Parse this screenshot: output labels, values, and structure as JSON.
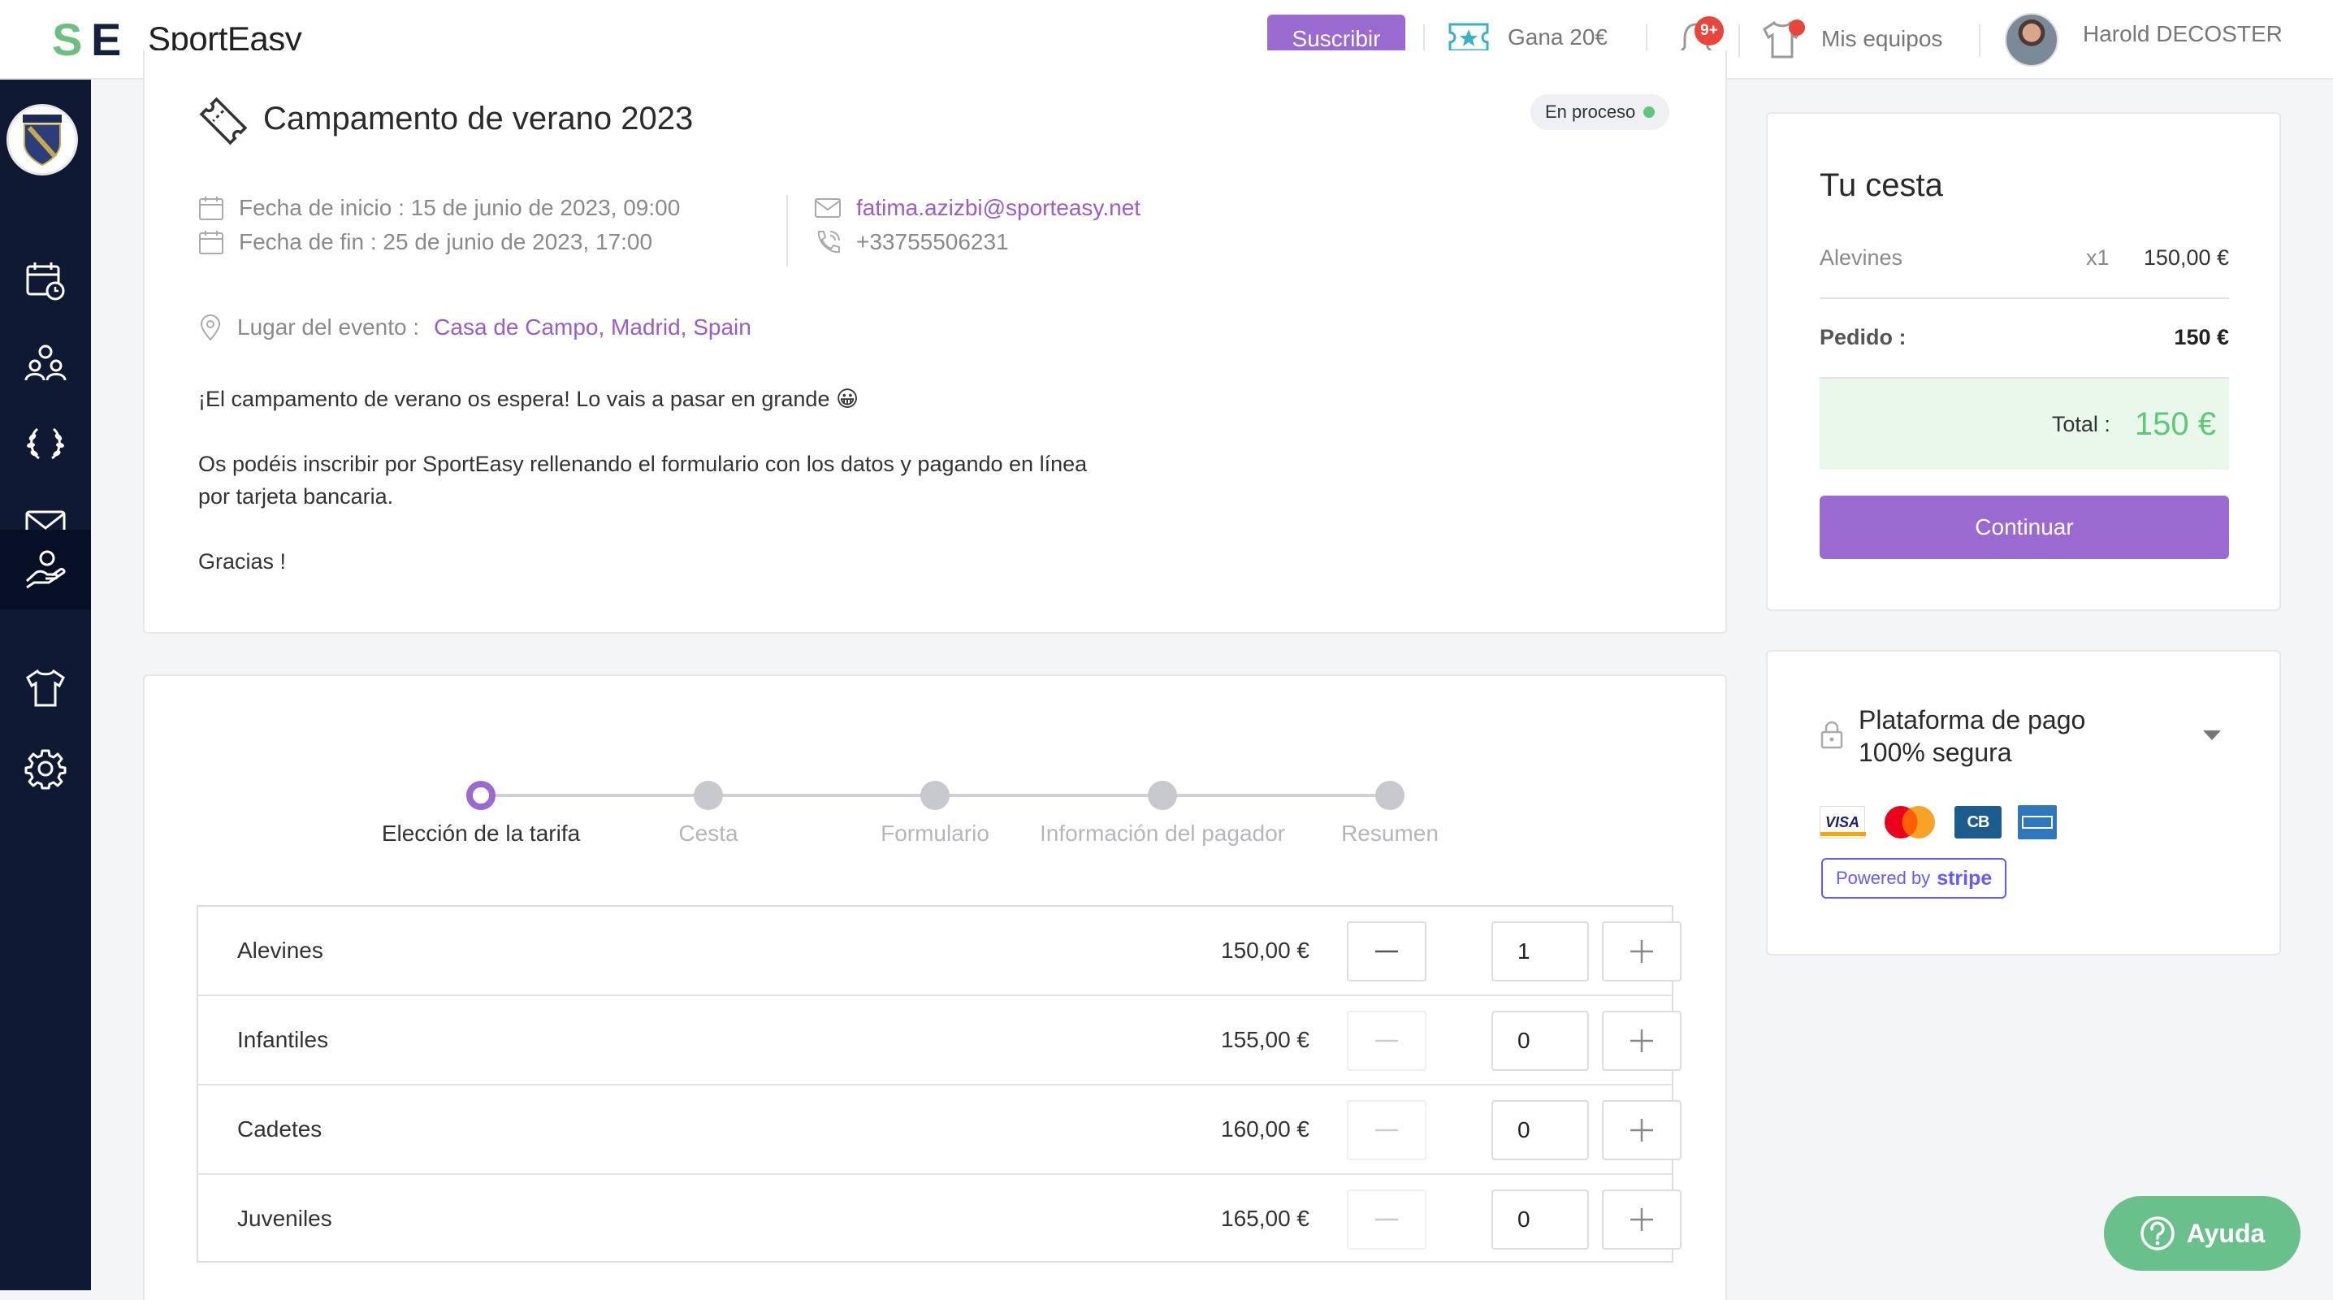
{
  "header": {
    "brand": "SportEasy",
    "logo_mark": "SE",
    "subscribe": "Suscribir",
    "earn": "Gana 20€",
    "notifications_badge": "9+",
    "teams": "Mis equipos",
    "user": "Harold DECOSTER"
  },
  "event": {
    "title": "Campamento de verano 2023",
    "status": "En proceso",
    "start": "Fecha de inicio : 15 de junio de 2023, 09:00",
    "end": "Fecha de fin : 25 de junio de 2023, 17:00",
    "email": "fatima.azizbi@sporteasy.net",
    "phone": "+33755506231",
    "location_label": "Lugar del evento :",
    "location": "Casa de Campo, Madrid, Spain",
    "description": [
      "¡El campamento de verano os espera! Lo vais a pasar en grande 😀",
      "Os podéis inscribir por SportEasy rellenando el formulario con los datos y pagando en línea",
      "por tarjeta bancaria.",
      "Gracias !"
    ]
  },
  "steps": [
    "Elección de la tarifa",
    "Cesta",
    "Formulario",
    "Información del pagador",
    "Resumen"
  ],
  "rates": [
    {
      "name": "Alevines",
      "price": "150,00 €",
      "qty": "1"
    },
    {
      "name": "Infantiles",
      "price": "155,00 €",
      "qty": "0"
    },
    {
      "name": "Cadetes",
      "price": "160,00 €",
      "qty": "0"
    },
    {
      "name": "Juveniles",
      "price": "165,00 €",
      "qty": "0"
    }
  ],
  "basket": {
    "title": "Tu cesta",
    "item_name": "Alevines",
    "item_qty": "x1",
    "item_price": "150,00 €",
    "order_label": "Pedido :",
    "order_value": "150 €",
    "total_label": "Total :",
    "total_value": "150 €",
    "continue": "Continuar"
  },
  "payment": {
    "title_line1": "Plataforma de pago",
    "title_line2": "100% segura",
    "card_visa": "VISA",
    "card_cb": "CB",
    "powered_by": "Powered by",
    "stripe": "stripe"
  },
  "help": "Ayuda",
  "colors": {
    "accent": "#9b6ad0",
    "sidebar": "#0f1933",
    "success": "#5fc77a",
    "help": "#69c08a"
  }
}
